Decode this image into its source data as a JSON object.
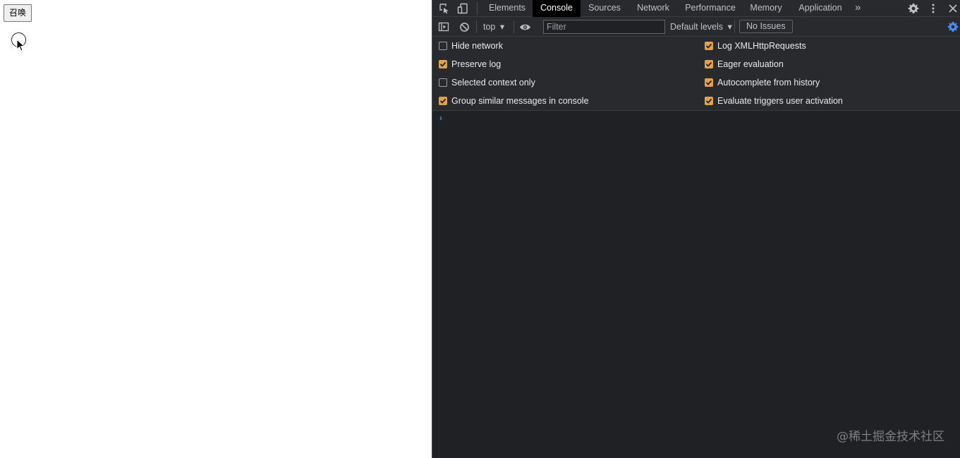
{
  "page": {
    "button_label": "召唤"
  },
  "devtools": {
    "tabs": [
      {
        "label": "Elements"
      },
      {
        "label": "Console"
      },
      {
        "label": "Sources"
      },
      {
        "label": "Network"
      },
      {
        "label": "Performance"
      },
      {
        "label": "Memory"
      },
      {
        "label": "Application"
      }
    ],
    "active_tab": "Console",
    "more_tabs_glyph": "»",
    "toolbar": {
      "context": "top",
      "context_arrow": "▾",
      "filter_placeholder": "Filter",
      "levels": "Default levels",
      "levels_arrow": "▾",
      "issues": "No Issues"
    },
    "settings": {
      "left": [
        {
          "label": "Hide network",
          "checked": false
        },
        {
          "label": "Preserve log",
          "checked": true
        },
        {
          "label": "Selected context only",
          "checked": false
        },
        {
          "label": "Group similar messages in console",
          "checked": true
        }
      ],
      "right": [
        {
          "label": "Log XMLHttpRequests",
          "checked": true
        },
        {
          "label": "Eager evaluation",
          "checked": true
        },
        {
          "label": "Autocomplete from history",
          "checked": true
        },
        {
          "label": "Evaluate triggers user activation",
          "checked": true
        }
      ]
    },
    "prompt_glyph": "›"
  },
  "watermark": "@稀土掘金技术社区",
  "colors": {
    "checkbox_checked": "#e3a246",
    "panel_bg": "#202124",
    "toolbar_bg": "#292a2d",
    "accent_blue": "#4a8ef5"
  }
}
